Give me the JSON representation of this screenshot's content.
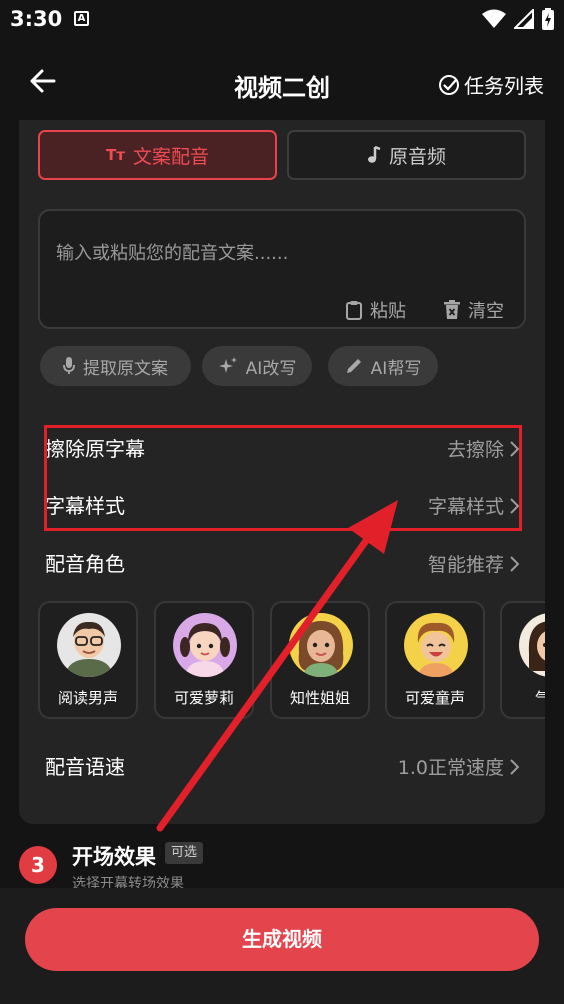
{
  "status_bar": {
    "time": "3:30",
    "notification_letter": "A"
  },
  "header": {
    "title": "视频二创",
    "task_list_label": "任务列表"
  },
  "tabs": [
    {
      "icon_text": "Tт",
      "label": "文案配音",
      "active": true
    },
    {
      "label": "原音频",
      "active": false
    }
  ],
  "text_input": {
    "placeholder": "输入或粘贴您的配音文案......",
    "paste_label": "粘贴",
    "clear_label": "清空"
  },
  "chips": [
    {
      "label": "提取原文案",
      "icon": "microphone-icon"
    },
    {
      "label": "AI改写",
      "icon": "sparkle-icon"
    },
    {
      "label": "AI帮写",
      "icon": "pencil-icon"
    }
  ],
  "settings": {
    "remove_subtitle": {
      "label": "擦除原字幕",
      "action": "去擦除"
    },
    "subtitle_style": {
      "label": "字幕样式",
      "action": "字幕样式"
    },
    "voice_role": {
      "label": "配音角色",
      "action": "智能推荐"
    },
    "voice_speed": {
      "label": "配音语速",
      "action": "1.0正常速度"
    }
  },
  "voices": [
    {
      "name": "阅读男声"
    },
    {
      "name": "可爱萝莉"
    },
    {
      "name": "知性姐姐"
    },
    {
      "name": "可爱童声"
    },
    {
      "name": "气质"
    }
  ],
  "step": {
    "number": "3",
    "title": "开场效果",
    "tag": "可选",
    "subtitle": "选择开幕转场效果"
  },
  "generate_button": "生成视频",
  "colors": {
    "accent": "#e4444b",
    "annotation_red": "#e2202a",
    "background": "#141414",
    "panel": "#242424"
  }
}
